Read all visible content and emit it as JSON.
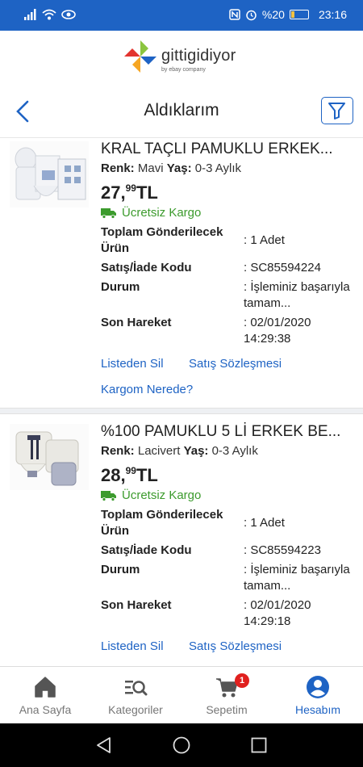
{
  "status_bar": {
    "battery_text": "%20",
    "time": "23:16",
    "battery_level": 0.2
  },
  "brand": {
    "name": "gittigidiyor",
    "sub": "by ebay company"
  },
  "nav": {
    "title": "Aldıklarım"
  },
  "orders": [
    {
      "title": "KRAL TAÇLI PAMUKLU ERKEK...",
      "variant_color_label": "Renk:",
      "variant_color": "Mavi",
      "variant_age_label": "Yaş:",
      "variant_age": "0-3 Aylık",
      "price_int": "27,",
      "price_dec": "99",
      "currency": "TL",
      "shipping": "Ücretsiz Kargo",
      "qty_label": "Toplam Gönderilecek Ürün",
      "qty_value": ": 1 Adet",
      "code_label": "Satış/İade Kodu",
      "code_value": ": SC85594224",
      "status_label": "Durum",
      "status_value": ": İşleminiz başarıyla tamam...",
      "last_label": "Son Hareket",
      "last_value": ": 02/01/2020 14:29:38",
      "link_remove": "Listeden Sil",
      "link_contract": "Satış Sözleşmesi",
      "link_cargo": "Kargom Nerede?"
    },
    {
      "title": "%100 PAMUKLU 5 Lİ ERKEK BE...",
      "variant_color_label": "Renk:",
      "variant_color": "Lacivert",
      "variant_age_label": "Yaş:",
      "variant_age": "0-3 Aylık",
      "price_int": "28,",
      "price_dec": "99",
      "currency": "TL",
      "shipping": "Ücretsiz Kargo",
      "qty_label": "Toplam Gönderilecek Ürün",
      "qty_value": ": 1 Adet",
      "code_label": "Satış/İade Kodu",
      "code_value": ": SC85594223",
      "status_label": "Durum",
      "status_value": ": İşleminiz başarıyla tamam...",
      "last_label": "Son Hareket",
      "last_value": ": 02/01/2020 14:29:18",
      "link_remove": "Listeden Sil",
      "link_contract": "Satış Sözleşmesi"
    }
  ],
  "tabs": [
    {
      "label": "Ana Sayfa",
      "icon": "home-icon"
    },
    {
      "label": "Kategoriler",
      "icon": "category-search-icon"
    },
    {
      "label": "Sepetim",
      "icon": "cart-icon",
      "badge": "1"
    },
    {
      "label": "Hesabım",
      "icon": "account-icon",
      "active": true
    }
  ],
  "colors": {
    "brand_blue": "#1e63c4",
    "shipping_green": "#3c9b2d",
    "badge_red": "#e0201e"
  }
}
